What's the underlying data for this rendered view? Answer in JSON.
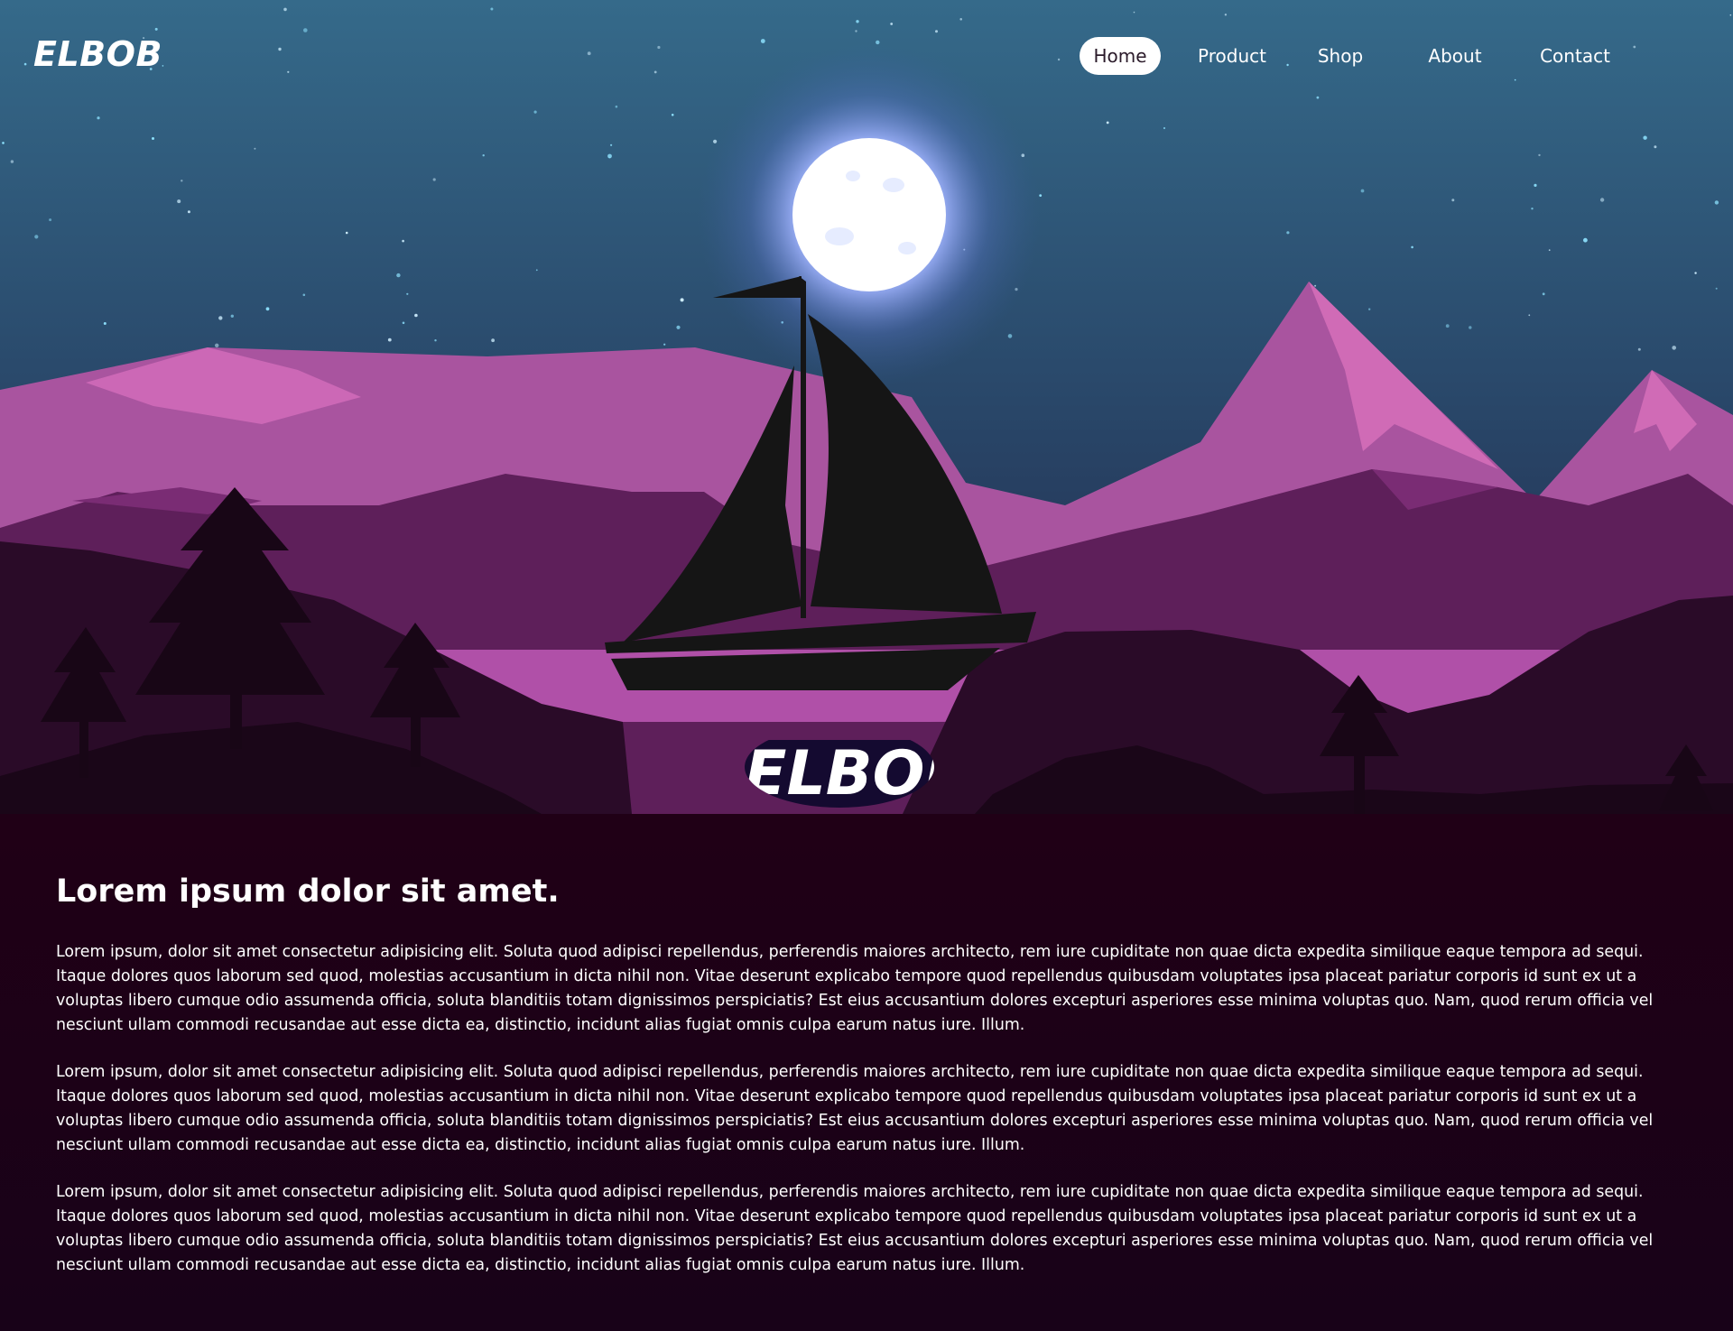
{
  "header": {
    "logo": "ELBOB",
    "nav": [
      {
        "label": "Home",
        "active": true
      },
      {
        "label": "Product",
        "active": false
      },
      {
        "label": "Shop",
        "active": false
      },
      {
        "label": "About",
        "active": false
      },
      {
        "label": "Contact",
        "active": false
      }
    ]
  },
  "hero": {
    "watermark_text": "ELBOB"
  },
  "main": {
    "heading": "Lorem ipsum dolor sit amet.",
    "paragraphs": [
      "Lorem ipsum, dolor sit amet consectetur adipisicing elit. Soluta quod adipisci repellendus, perferendis maiores architecto, rem iure cupiditate non quae dicta expedita similique eaque tempora ad sequi. Itaque dolores quos laborum sed quod, molestias accusantium in dicta nihil non. Vitae deserunt explicabo tempore quod repellendus quibusdam voluptates ipsa placeat pariatur corporis id sunt ex ut a voluptas libero cumque odio assumenda officia, soluta blanditiis totam dignissimos perspiciatis? Est eius accusantium dolores excepturi asperiores esse minima voluptas quo. Nam, quod rerum officia vel nesciunt ullam commodi recusandae aut esse dicta ea, distinctio, incidunt alias fugiat omnis culpa earum natus iure. Illum.",
      "Lorem ipsum, dolor sit amet consectetur adipisicing elit. Soluta quod adipisci repellendus, perferendis maiores architecto, rem iure cupiditate non quae dicta expedita similique eaque tempora ad sequi. Itaque dolores quos laborum sed quod, molestias accusantium in dicta nihil non. Vitae deserunt explicabo tempore quod repellendus quibusdam voluptates ipsa placeat pariatur corporis id sunt ex ut a voluptas libero cumque odio assumenda officia, soluta blanditiis totam dignissimos perspiciatis? Est eius accusantium dolores excepturi asperiores esse minima voluptas quo. Nam, quod rerum officia vel nesciunt ullam commodi recusandae aut esse dicta ea, distinctio, incidunt alias fugiat omnis culpa earum natus iure. Illum.",
      "Lorem ipsum, dolor sit amet consectetur adipisicing elit. Soluta quod adipisci repellendus, perferendis maiores architecto, rem iure cupiditate non quae dicta expedita similique eaque tempora ad sequi. Itaque dolores quos laborum sed quod, molestias accusantium in dicta nihil non. Vitae deserunt explicabo tempore quod repellendus quibusdam voluptates ipsa placeat pariatur corporis id sunt ex ut a voluptas libero cumque odio assumenda officia, soluta blanditiis totam dignissimos perspiciatis? Est eius accusantium dolores excepturi asperiores esse minima voluptas quo. Nam, quod rerum officia vel nesciunt ullam commodi recusandae aut esse dicta ea, distinctio, incidunt alias fugiat omnis culpa earum natus iure. Illum."
    ]
  },
  "colors": {
    "sky_top": "#2f6585",
    "sky_bottom": "#1f2a4a",
    "mountain_light": "#c868b4",
    "mountain_mid": "#a85aa0",
    "hills_dark": "#5a1f58",
    "foreground": "#1c0818",
    "content_bg": "#1b0119",
    "boat": "#151515",
    "text": "#ffffff",
    "nav_active_bg": "#ffffff"
  }
}
